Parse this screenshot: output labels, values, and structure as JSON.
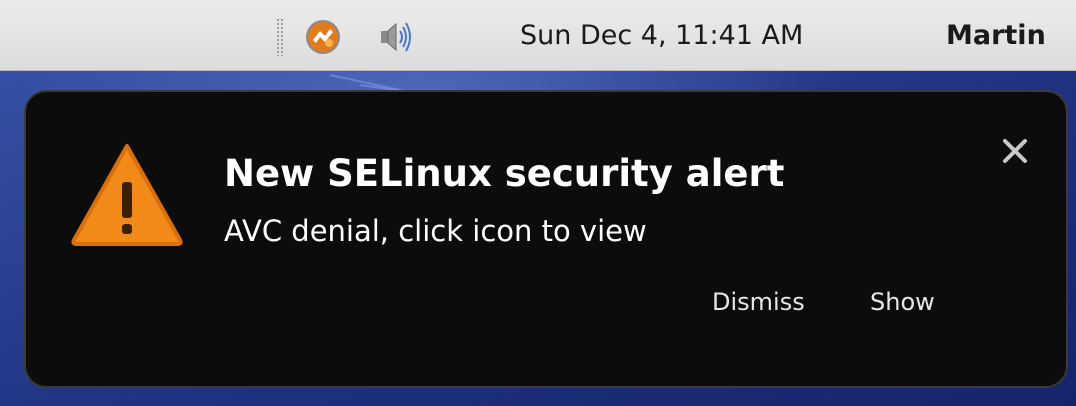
{
  "panel": {
    "tray": [
      {
        "icon": "software-update-icon"
      },
      {
        "icon": "volume-icon"
      }
    ],
    "clock": "Sun Dec  4, 11:41 AM",
    "user": "Martin"
  },
  "notification": {
    "icon": "warning-icon",
    "title": "New SELinux security alert",
    "body": "AVC denial, click icon to view",
    "actions": {
      "dismiss": "Dismiss",
      "show": "Show"
    },
    "close_icon": "close-icon"
  },
  "colors": {
    "bubble_bg": "#0c0c0c",
    "warning_orange": "#f28a1a",
    "panel_bg": "#e4e4e4",
    "desktop_blue": "#2a3f8a"
  }
}
